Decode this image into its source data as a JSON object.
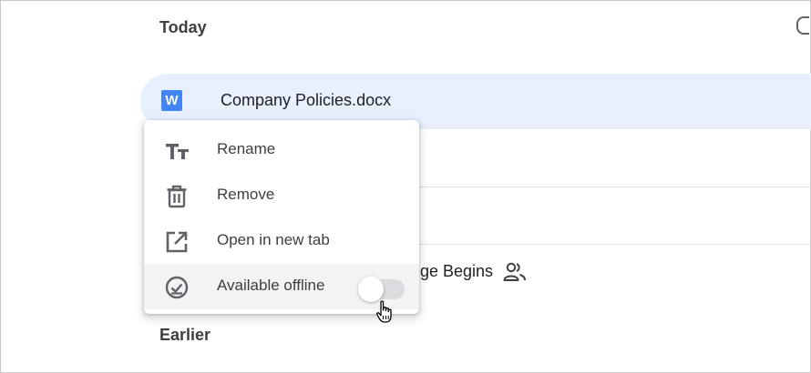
{
  "sections": {
    "today": "Today",
    "earlier": "Earlier"
  },
  "file_row": {
    "icon_letter": "W",
    "name": "Company Policies.docx"
  },
  "partially_hidden_file": {
    "visible_text": "ge Begins",
    "shared_icon": "people-icon"
  },
  "context_menu": {
    "items": [
      {
        "label": "Rename",
        "icon": "text-format-icon"
      },
      {
        "label": "Remove",
        "icon": "trash-icon"
      },
      {
        "label": "Open in new tab",
        "icon": "open-in-new-icon"
      },
      {
        "label": "Available offline",
        "icon": "offline-check-icon",
        "toggle": {
          "on": false
        }
      }
    ]
  },
  "colors": {
    "selected_row": "#e8f0fe",
    "word_icon": "#4285f4",
    "menu_highlight": "#f1f3f4",
    "toggle_track": "#dadce0"
  }
}
